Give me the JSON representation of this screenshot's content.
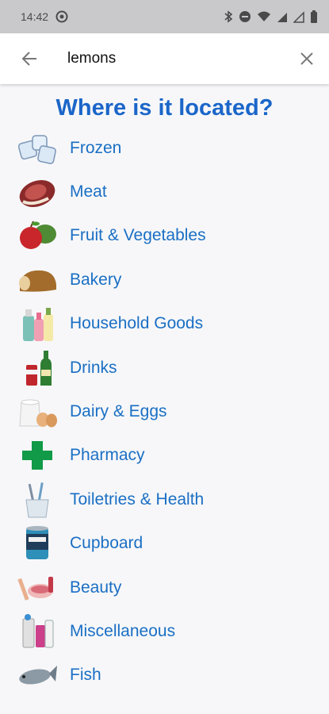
{
  "status": {
    "time": "14:42"
  },
  "search": {
    "value": "lemons",
    "placeholder": ""
  },
  "title": "Where is it located?",
  "categories": [
    {
      "label": "Frozen",
      "icon": "ice-cubes-icon"
    },
    {
      "label": "Meat",
      "icon": "steak-icon"
    },
    {
      "label": "Fruit & Vegetables",
      "icon": "apple-vegetables-icon"
    },
    {
      "label": "Bakery",
      "icon": "bread-loaf-icon"
    },
    {
      "label": "Household Goods",
      "icon": "cleaning-bottles-icon"
    },
    {
      "label": "Drinks",
      "icon": "drink-bottles-icon"
    },
    {
      "label": "Dairy & Eggs",
      "icon": "milk-eggs-icon"
    },
    {
      "label": "Pharmacy",
      "icon": "pharmacy-cross-icon"
    },
    {
      "label": "Toiletries & Health",
      "icon": "toothbrush-cup-icon"
    },
    {
      "label": "Cupboard",
      "icon": "tin-can-icon"
    },
    {
      "label": "Beauty",
      "icon": "makeup-icon"
    },
    {
      "label": "Miscellaneous",
      "icon": "misc-items-icon"
    },
    {
      "label": "Fish",
      "icon": "fish-icon"
    }
  ],
  "colors": {
    "accent": "#1b66c9",
    "label": "#1a6fc4",
    "statusbar": "#c9c9cc"
  }
}
